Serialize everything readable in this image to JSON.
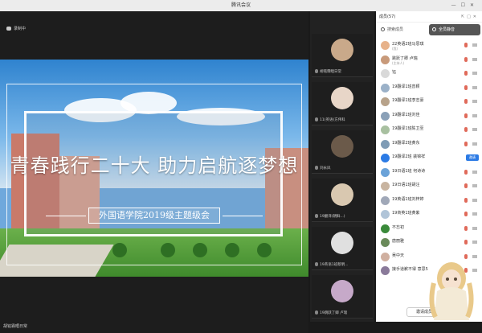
{
  "window": {
    "title": "腾讯会议"
  },
  "stage": {
    "recording_label": "录制中"
  },
  "slide": {
    "headline": "青春践行二十大  助力启航逐梦想",
    "subtitle": "外国语学院2019级主题级会"
  },
  "bottombar": {
    "presenter": "胡铭霖晒日常"
  },
  "thumbnails": [
    {
      "name": "胡铭霖晒日常"
    },
    {
      "name": "11(英语)方伟科"
    },
    {
      "name": "刘永凤"
    },
    {
      "name": "19翻译(朝鲜...)"
    },
    {
      "name": "19英语1班蔡明..."
    },
    {
      "name": "19跳跃了卿 卢瑞"
    }
  ],
  "panel": {
    "header": "成员(57)",
    "tabs": {
      "search": "搜索成员",
      "mute_all": "全员静音"
    },
    "members": [
      {
        "name": "22英语2班马思琪",
        "sub": "(我)"
      },
      {
        "name": "跳跃了卿 卢瑞",
        "sub": "(主持人)"
      },
      {
        "name": "钰",
        "sub": ""
      },
      {
        "name": "19翻译1班曾颖",
        "sub": ""
      },
      {
        "name": "19翻译1班李志豪",
        "sub": ""
      },
      {
        "name": "19翻译1班刘佳",
        "sub": ""
      },
      {
        "name": "19翻译1班陈卫至",
        "sub": ""
      },
      {
        "name": "19翻译2班黄东",
        "sub": ""
      },
      {
        "name": "19翻译2班 裴锦祥",
        "sub": "",
        "button": "邀请"
      },
      {
        "name": "19日语1班 何诗诗",
        "sub": ""
      },
      {
        "name": "19日语1班胡汪",
        "sub": ""
      },
      {
        "name": "19英语1班刘梓婷",
        "sub": ""
      },
      {
        "name": "19商英1班黄紫",
        "sub": ""
      },
      {
        "name": "不忘初",
        "sub": ""
      },
      {
        "name": "唐丽雅",
        "sub": ""
      },
      {
        "name": "吴中天",
        "sub": ""
      },
      {
        "name": "接手道歉不得 意思5",
        "sub": ""
      }
    ],
    "invite_label": "邀请成员"
  }
}
